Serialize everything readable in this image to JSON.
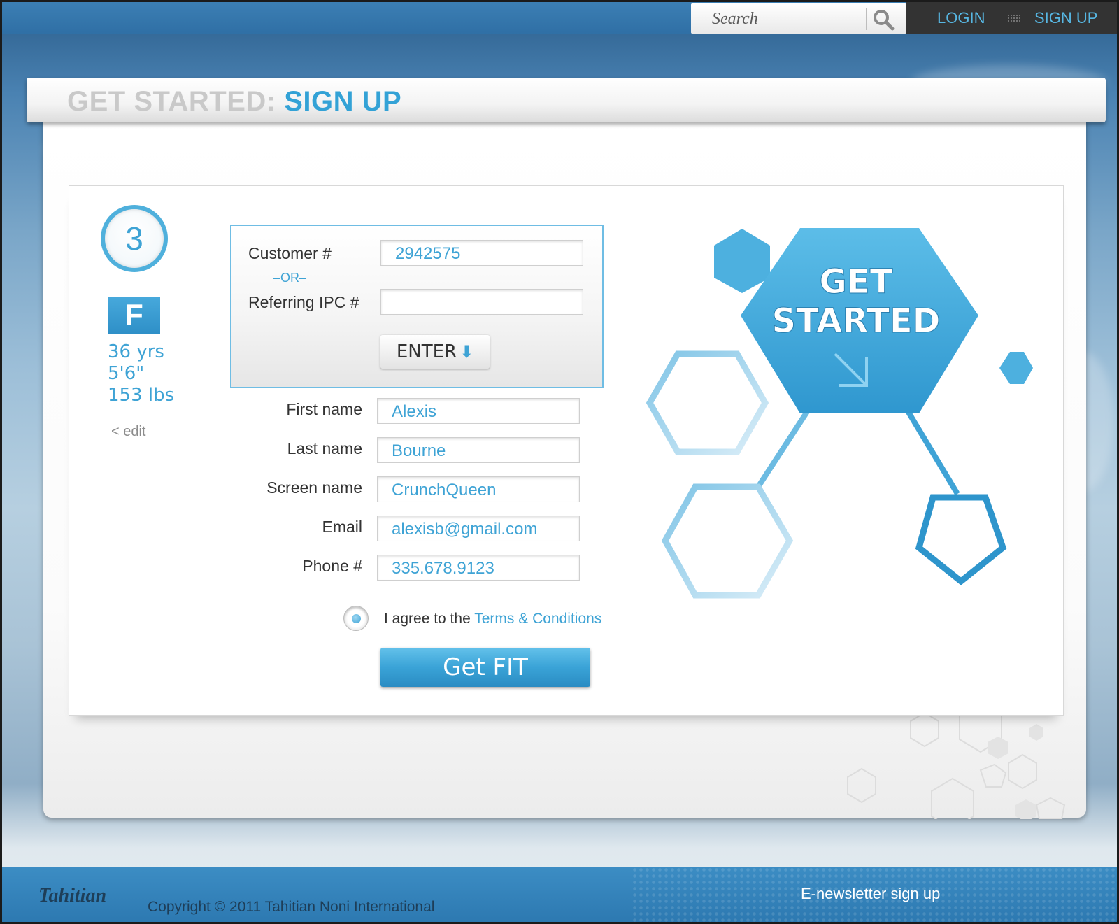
{
  "topbar": {
    "search_placeholder": "Search",
    "login_label": "LOGIN",
    "signup_label": "SIGN UP"
  },
  "header": {
    "title_prefix": "GET STARTED:",
    "title_main": "SIGN UP"
  },
  "profile": {
    "step_number": "3",
    "gender": "F",
    "age": "36 yrs",
    "height": "5'6\"",
    "weight": "153 lbs",
    "edit_label": "< edit"
  },
  "customer_box": {
    "customer_label": "Customer #",
    "customer_value": "2942575",
    "or_label": "–OR–",
    "referring_label": "Referring IPC #",
    "referring_value": "",
    "enter_label": "ENTER"
  },
  "form": {
    "first_name_label": "First name",
    "first_name_value": "Alexis",
    "last_name_label": "Last name",
    "last_name_value": "Bourne",
    "screen_name_label": "Screen name",
    "screen_name_value": "CrunchQueen",
    "email_label": "Email",
    "email_value": "alexisb@gmail.com",
    "phone_label": "Phone #",
    "phone_value": "335.678.9123",
    "agree_text": "I agree to the",
    "terms_link": "Terms & Conditions",
    "submit_label": "Get FIT"
  },
  "hero": {
    "line1": "GET",
    "line2": "STARTED"
  },
  "footer": {
    "logo_text": "Tahitian",
    "copyright": "Copyright © 2011 Tahitian Noni International",
    "newsletter_label": "E-newsletter sign up"
  },
  "colors": {
    "accent": "#3ea3d5",
    "topbar": "#2f6fa5",
    "auth_bg": "#333333"
  }
}
